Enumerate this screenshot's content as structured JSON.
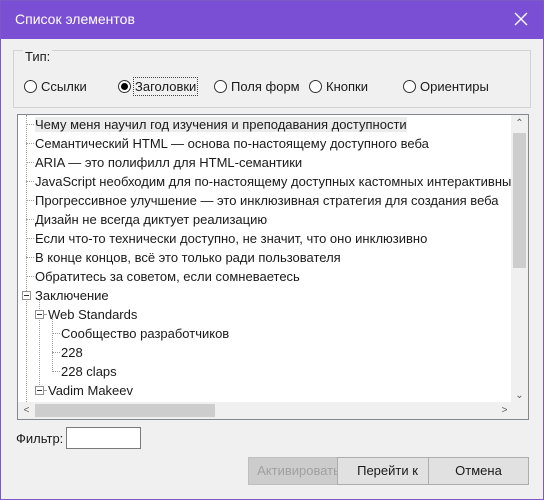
{
  "window": {
    "title": "Список элементов"
  },
  "type_group": {
    "label": "Тип:",
    "options": [
      {
        "label": "Ссылки",
        "selected": false
      },
      {
        "label": "Заголовки",
        "selected": true
      },
      {
        "label": "Поля форм",
        "selected": false
      },
      {
        "label": "Кнопки",
        "selected": false
      },
      {
        "label": "Ориентиры",
        "selected": false
      }
    ]
  },
  "tree": {
    "items": [
      {
        "text": "Чему меня научил год изучения и преподавания доступности",
        "selected": true
      },
      {
        "text": "Семантический HTML — основа по-настоящему доступного веба"
      },
      {
        "text": "ARIA — это полифилл для HTML-семантики"
      },
      {
        "text": "JavaScript необходим для по-настоящему доступных кастомных интерактивных комп"
      },
      {
        "text": "Прогрессивное улучшение — это инклюзивная стратегия для создания веба"
      },
      {
        "text": "Дизайн не всегда диктует реализацию"
      },
      {
        "text": "Если что-то технически доступно, не значит, что оно инклюзивно"
      },
      {
        "text": "В конце концов, всё это только ради пользователя"
      },
      {
        "text": "Обратитесь за советом, если сомневаетесь"
      },
      {
        "text": "Заключение"
      },
      {
        "text": "Web Standards"
      },
      {
        "text": "Сообщество разработчиков"
      },
      {
        "text": "228"
      },
      {
        "text": "228 claps"
      },
      {
        "text": "Vadim Makeev"
      }
    ]
  },
  "filter": {
    "label": "Фильтр:",
    "value": ""
  },
  "buttons": {
    "activate": "Активировать",
    "goto": "Перейти к",
    "cancel": "Отмена"
  }
}
